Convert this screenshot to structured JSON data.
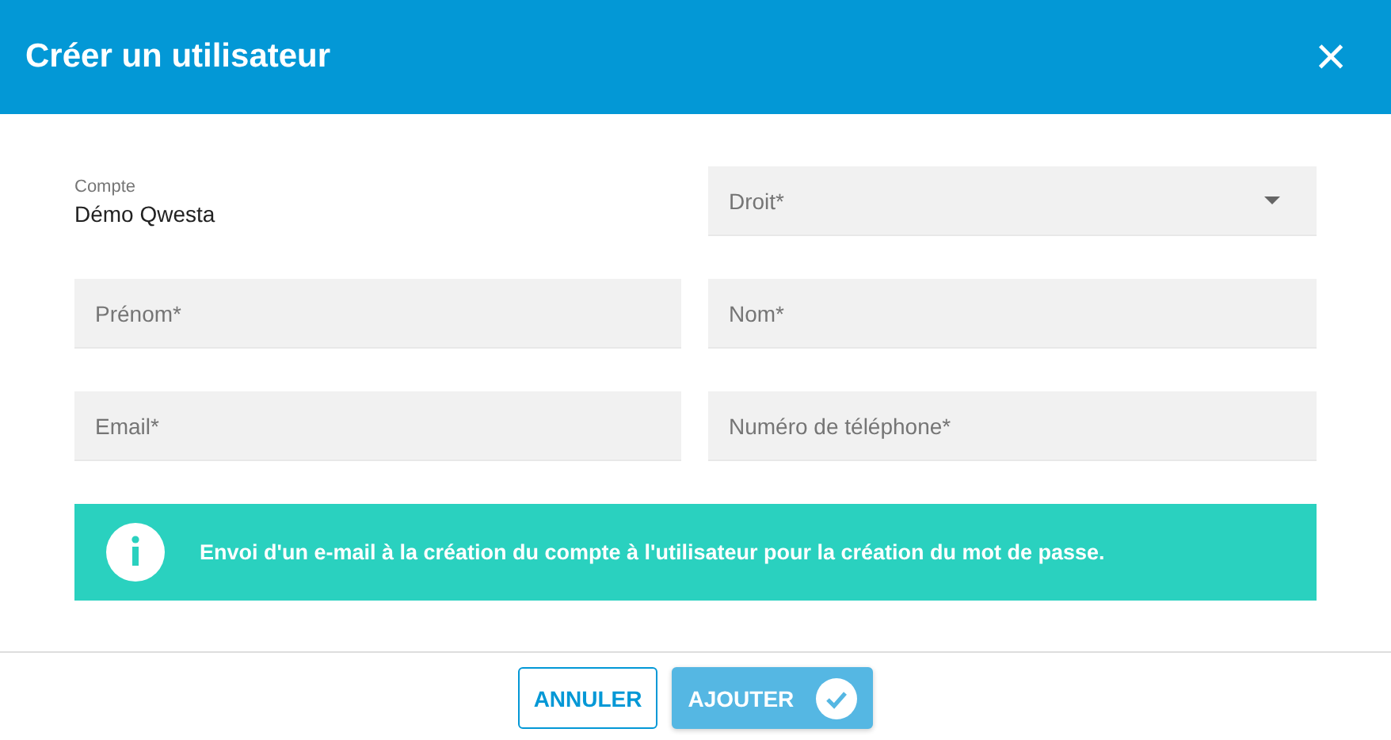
{
  "dialog": {
    "title": "Créer un utilisateur",
    "close": "×"
  },
  "account": {
    "label": "Compte",
    "value": "Démo Qwesta"
  },
  "fields": [
    {
      "kind": "select",
      "placeholder": "Droit*"
    },
    {
      "kind": "text",
      "placeholder": "Prénom*"
    },
    {
      "kind": "text",
      "placeholder": "Nom*"
    },
    {
      "kind": "text",
      "placeholder": "Email*"
    },
    {
      "kind": "text",
      "placeholder": "Numéro de téléphone*"
    }
  ],
  "info": {
    "message": "Envoi d'un e-mail à la création du compte à l'utilisateur pour la création du mot de passe."
  },
  "buttons": [
    {
      "kind": "outline",
      "label": "ANNULER",
      "disabled": false
    },
    {
      "kind": "primary",
      "label": "AJOUTER",
      "disabled": true
    }
  ]
}
